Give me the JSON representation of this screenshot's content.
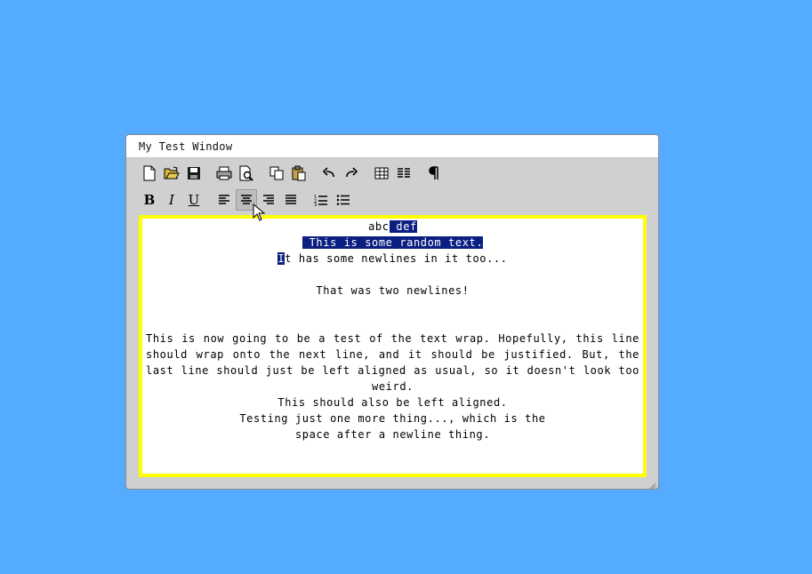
{
  "window": {
    "title": "My Test Window"
  },
  "toolbar": {
    "row1": [
      {
        "name": "new-file-icon"
      },
      {
        "name": "open-folder-icon"
      },
      {
        "name": "save-icon"
      },
      {
        "name": "print-icon"
      },
      {
        "name": "print-preview-icon"
      },
      {
        "name": "copy-icon"
      },
      {
        "name": "paste-icon"
      },
      {
        "name": "undo-icon"
      },
      {
        "name": "redo-icon"
      },
      {
        "name": "table-icon"
      },
      {
        "name": "columns-icon"
      },
      {
        "name": "pilcrow-icon"
      }
    ],
    "bold_label": "B",
    "italic_label": "I",
    "underline_label": "U",
    "active_button": "align-center"
  },
  "editor": {
    "line1_pre": "abc",
    "line1_sel": " def",
    "line2_sel": " This is some random text.",
    "line3_sel": "I",
    "line3_rest": "t has some newlines in it too...",
    "line4": "That was two newlines!",
    "para_wrap": "This is now going to be a test of the text wrap. Hopefully, this line should wrap onto the next line, and it should be justified. But, the last line should just be left aligned as usual, so it doesn't look too weird.",
    "line_left": "This should also be left aligned.",
    "line_testing1": "Testing just one more thing..., which is the",
    "line_testing2": "space after a newline thing.",
    "border_color": "#ffff00",
    "selection_color": "#0b1f82"
  },
  "colors": {
    "desktop": "#54abff",
    "window_body": "#d0d0d0"
  }
}
